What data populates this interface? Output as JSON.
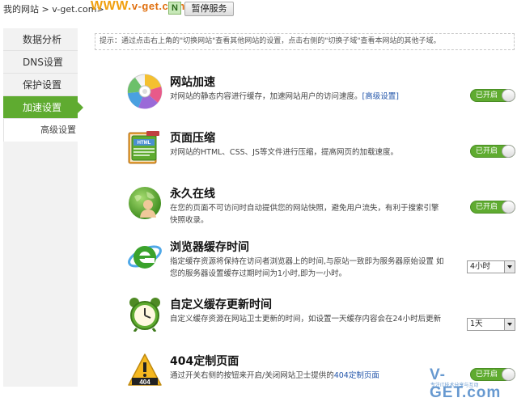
{
  "topbar": {
    "crumb_home": "我的网站",
    "crumb_sep": ">",
    "crumb_site": "v-get.com>",
    "logo_www": "WWW.",
    "logo_domain": "v-get.com",
    "badge_letter": "N",
    "pause_label": "暂停服务"
  },
  "sidebar": {
    "items": [
      {
        "label": "数据分析"
      },
      {
        "label": "DNS设置"
      },
      {
        "label": "保护设置"
      },
      {
        "label": "加速设置"
      }
    ],
    "sub_item": "高级设置"
  },
  "tip": "提示：通过点击右上角的\"切换网站\"查看其他网站的设置，点击右侧的\"切换子域\"查看本网站的其他子域。",
  "features": [
    {
      "title": "网站加速",
      "desc": "对网站的静态内容进行缓存，加速网站用户的访问速度。",
      "link": "[高级设置]",
      "control": "toggle",
      "state": "已开启"
    },
    {
      "title": "页面压缩",
      "desc": "对网站的HTML、CSS、JS等文件进行压缩，提高网页的加载速度。",
      "control": "toggle",
      "state": "已开启"
    },
    {
      "title": "永久在线",
      "desc": "在您的页面不可访问时自动提供您的网站快照，避免用户流失，有利于搜索引擎快照收录。",
      "control": "toggle",
      "state": "已开启"
    },
    {
      "title": "浏览器缓存时间",
      "desc": "指定缓存资源将保持在访问者浏览器上的时间,与原站一致即为服务器原始设置 如您的服务器设置缓存过期时间为1小时,即为一小时。",
      "control": "select",
      "value": "4小时"
    },
    {
      "title": "自定义缓存更新时间",
      "desc": "自定义缓存资源在网站卫士更新的时间，如设置一天缓存内容会在24小时后更新",
      "control": "select",
      "value": "1天"
    },
    {
      "title": "404定制页面",
      "desc": "通过开关右侧的按钮来开启/关闭网站卫士提供的",
      "link": "404定制页面",
      "control": "toggle",
      "state": "已开启"
    }
  ],
  "icons": {
    "cd": "cd-disc-icon",
    "html": "html-compress-icon",
    "online": "globe-user-icon",
    "browser": "ie-browser-icon",
    "clock": "alarm-clock-icon",
    "warn": "404-warning-icon"
  },
  "watermark": {
    "main": "V-GET.com",
    "sub": "专注IT技术分享与互动"
  },
  "colors": {
    "accent": "#5fab30",
    "link": "#2255aa",
    "logo": "#f0a010"
  }
}
